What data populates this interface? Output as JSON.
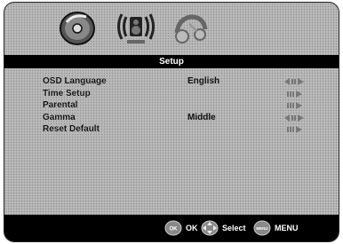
{
  "header": {
    "tabs": [
      {
        "icon": "disc-icon"
      },
      {
        "icon": "speaker-sound-icon"
      },
      {
        "icon": "setup-tools-icon"
      }
    ]
  },
  "title": "Setup",
  "menu": {
    "items": [
      {
        "label": "OSD Language",
        "value": "English",
        "arrow": "left-right-arrow-icon"
      },
      {
        "label": "Time Setup",
        "value": "",
        "arrow": "right-arrow-icon"
      },
      {
        "label": "Parental",
        "value": "",
        "arrow": "right-arrow-icon"
      },
      {
        "label": "Gamma",
        "value": "Middle",
        "arrow": "left-right-arrow-icon"
      },
      {
        "label": "Reset Default",
        "value": "",
        "arrow": "right-arrow-icon"
      }
    ]
  },
  "footer": {
    "ok_button_text": "OK",
    "ok_label": "OK",
    "select_label": "Select",
    "menu_button_text": "MENU",
    "menu_label": "MENU"
  },
  "colors": {
    "background": "#d8d8d8",
    "bar": "#000000",
    "text": "#111111"
  }
}
